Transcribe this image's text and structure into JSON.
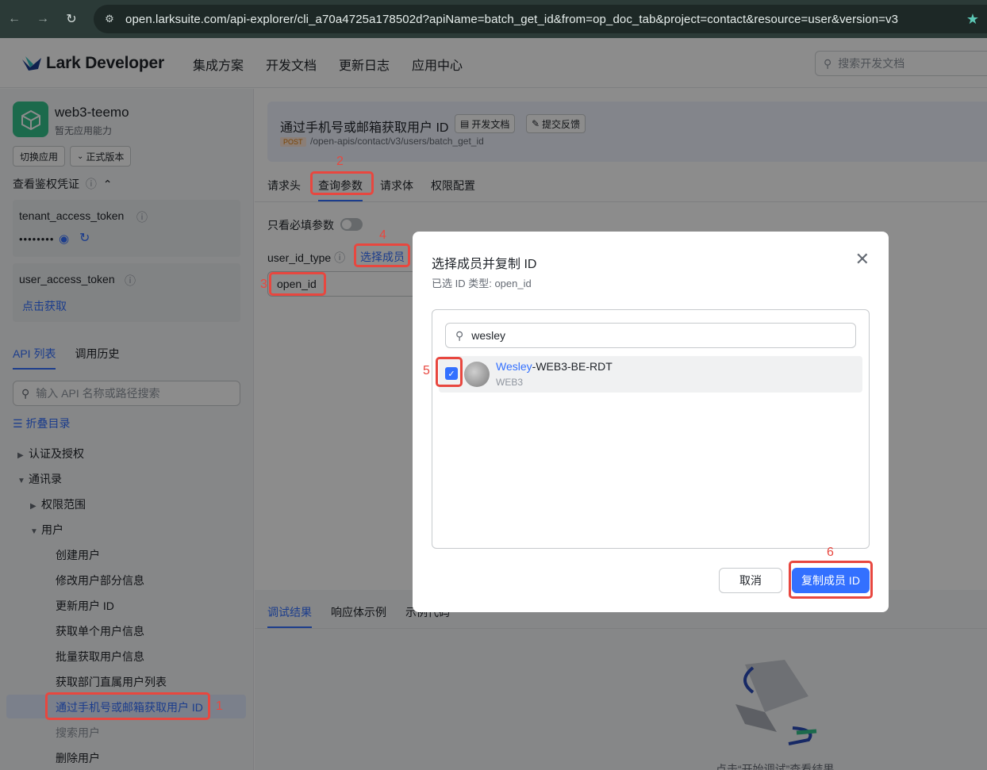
{
  "browser": {
    "url": "open.larksuite.com/api-explorer/cli_a70a4725a178502d?apiName=batch_get_id&from=op_doc_tab&project=contact&resource=user&version=v3"
  },
  "header": {
    "logo": "Lark Developer",
    "nav": [
      "集成方案",
      "开发文档",
      "更新日志",
      "应用中心"
    ],
    "search_placeholder": "搜索开发文档"
  },
  "sidebar": {
    "app_name": "web3-teemo",
    "app_sub": "暂无应用能力",
    "switch_app": "切换应用",
    "version": "正式版本",
    "auth_title": "查看鉴权凭证",
    "tenant_token_label": "tenant_access_token",
    "tenant_token_masked": "••••••••",
    "user_token_label": "user_access_token",
    "user_token_action": "点击获取",
    "tabs": [
      "API 列表",
      "调用历史"
    ],
    "api_search_placeholder": "输入 API 名称或路径搜索",
    "collapse": "折叠目录",
    "tree": {
      "auth": "认证及授权",
      "contacts": "通讯录",
      "scope": "权限范围",
      "user": "用户",
      "items": [
        "创建用户",
        "修改用户部分信息",
        "更新用户 ID",
        "获取单个用户信息",
        "批量获取用户信息",
        "获取部门直属用户列表",
        "通过手机号或邮箱获取用户 ID",
        "搜索用户",
        "删除用户"
      ]
    }
  },
  "main": {
    "api_title": "通过手机号或邮箱获取用户 ID",
    "doc_button": "开发文档",
    "feedback_button": "提交反馈",
    "method": "POST",
    "path": "/open-apis/contact/v3/users/batch_get_id",
    "tabs": [
      "请求头",
      "查询参数",
      "请求体",
      "权限配置"
    ],
    "only_required": "只看必填参数",
    "field_label": "user_id_type",
    "select_member": "选择成员",
    "field_value": "open_id",
    "debug_tabs": [
      "调试结果",
      "响应体示例",
      "示例代码"
    ],
    "debug_hint": "点击“开始调试”查看结果"
  },
  "modal": {
    "title": "选择成员并复制 ID",
    "subtitle": "已选 ID 类型: open_id",
    "search_value": "wesley",
    "member": {
      "name_highlight": "Wesley",
      "name_rest": "-WEB3-BE-RDT",
      "dept": "WEB3"
    },
    "cancel": "取消",
    "confirm": "复制成员 ID"
  },
  "annotations": [
    "1",
    "2",
    "3",
    "4",
    "5",
    "6"
  ],
  "colors": {
    "accent": "#3370ff",
    "annotation": "#e8473f",
    "app_icon": "#33c28a"
  }
}
